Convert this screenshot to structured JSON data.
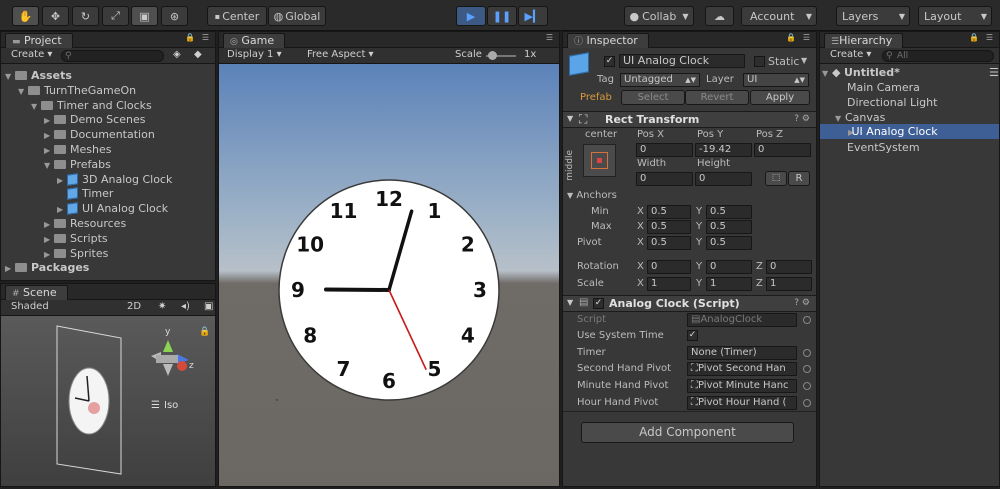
{
  "toolbar": {
    "tools": [
      "hand-icon",
      "move-icon",
      "rotate-icon",
      "scale-icon",
      "rect-tool-icon",
      "transform-icon"
    ],
    "center": "Center",
    "global": "Global",
    "collab": "Collab",
    "account": "Account",
    "layers": "Layers",
    "layout": "Layout"
  },
  "project": {
    "tab": "Project",
    "create": "Create",
    "items": [
      {
        "label": "Assets",
        "indent": 0,
        "type": "folder",
        "bold": true,
        "open": true
      },
      {
        "label": "TurnTheGameOn",
        "indent": 1,
        "type": "folder",
        "open": true
      },
      {
        "label": "Timer and Clocks",
        "indent": 2,
        "type": "folder",
        "open": true
      },
      {
        "label": "Demo Scenes",
        "indent": 3,
        "type": "folder"
      },
      {
        "label": "Documentation",
        "indent": 3,
        "type": "folder"
      },
      {
        "label": "Meshes",
        "indent": 3,
        "type": "folder"
      },
      {
        "label": "Prefabs",
        "indent": 3,
        "type": "folder",
        "open": true
      },
      {
        "label": "3D Analog Clock",
        "indent": 4,
        "type": "prefab"
      },
      {
        "label": "Timer",
        "indent": 4,
        "type": "prefab",
        "noarrow": true
      },
      {
        "label": "UI Analog Clock",
        "indent": 4,
        "type": "prefab"
      },
      {
        "label": "Resources",
        "indent": 3,
        "type": "folder"
      },
      {
        "label": "Scripts",
        "indent": 3,
        "type": "folder"
      },
      {
        "label": "Sprites",
        "indent": 3,
        "type": "folder"
      },
      {
        "label": "Packages",
        "indent": 0,
        "type": "folder",
        "bold": true
      }
    ]
  },
  "scene": {
    "tab": "Scene",
    "shading": "Shaded",
    "mode2d": "2D",
    "gizmo_y": "y",
    "gizmo_z": "z",
    "iso": "Iso"
  },
  "game": {
    "tab": "Game",
    "display": "Display 1",
    "aspect": "Free Aspect",
    "scale_label": "Scale",
    "scale_value": "1x",
    "numbers": [
      "12",
      "1",
      "2",
      "3",
      "4",
      "5",
      "6",
      "7",
      "8",
      "9",
      "10",
      "11"
    ],
    "time": {
      "hour": 9,
      "minute": 1,
      "second": 25
    }
  },
  "inspector": {
    "tab": "Inspector",
    "object_name": "UI Analog Clock",
    "static": "Static",
    "tag_label": "Tag",
    "tag": "Untagged",
    "layer_label": "Layer",
    "layer": "UI",
    "prefab": "Prefab",
    "select": "Select",
    "revert": "Revert",
    "apply": "Apply",
    "rect": {
      "title": "Rect Transform",
      "anchor_h": "center",
      "anchor_v": "middle",
      "posx_label": "Pos X",
      "posy_label": "Pos Y",
      "posz_label": "Pos Z",
      "posx": "0",
      "posy": "-19.42",
      "posz": "0",
      "width_label": "Width",
      "height_label": "Height",
      "width": "0",
      "height": "0",
      "r": "R",
      "anchors": "Anchors",
      "min": "Min",
      "max": "Max",
      "pivot": "Pivot",
      "min_x": "0.5",
      "min_y": "0.5",
      "max_x": "0.5",
      "max_y": "0.5",
      "pivot_x": "0.5",
      "pivot_y": "0.5",
      "rotation": "Rotation",
      "scale": "Scale",
      "rot_x": "0",
      "rot_y": "0",
      "rot_z": "0",
      "scale_x": "1",
      "scale_y": "1",
      "scale_z": "1",
      "X": "X",
      "Y": "Y",
      "Z": "Z"
    },
    "script": {
      "title": "Analog Clock (Script)",
      "script_label": "Script",
      "script_value": "AnalogClock",
      "use_system_time": "Use System Time",
      "timer": "Timer",
      "timer_value": "None (Timer)",
      "second_pivot": "Second Hand Pivot",
      "second_value": "Pivot Second Han",
      "minute_pivot": "Minute Hand Pivot",
      "minute_value": "Pivot Minute Hanc",
      "hour_pivot": "Hour Hand Pivot",
      "hour_value": "Pivot Hour Hand ("
    },
    "add_component": "Add Component"
  },
  "hierarchy": {
    "tab": "Hierarchy",
    "create": "Create",
    "search_placeholder": "All",
    "scene": "Untitled*",
    "items": [
      "Main Camera",
      "Directional Light",
      "Canvas",
      "UI Analog Clock",
      "EventSystem"
    ]
  }
}
